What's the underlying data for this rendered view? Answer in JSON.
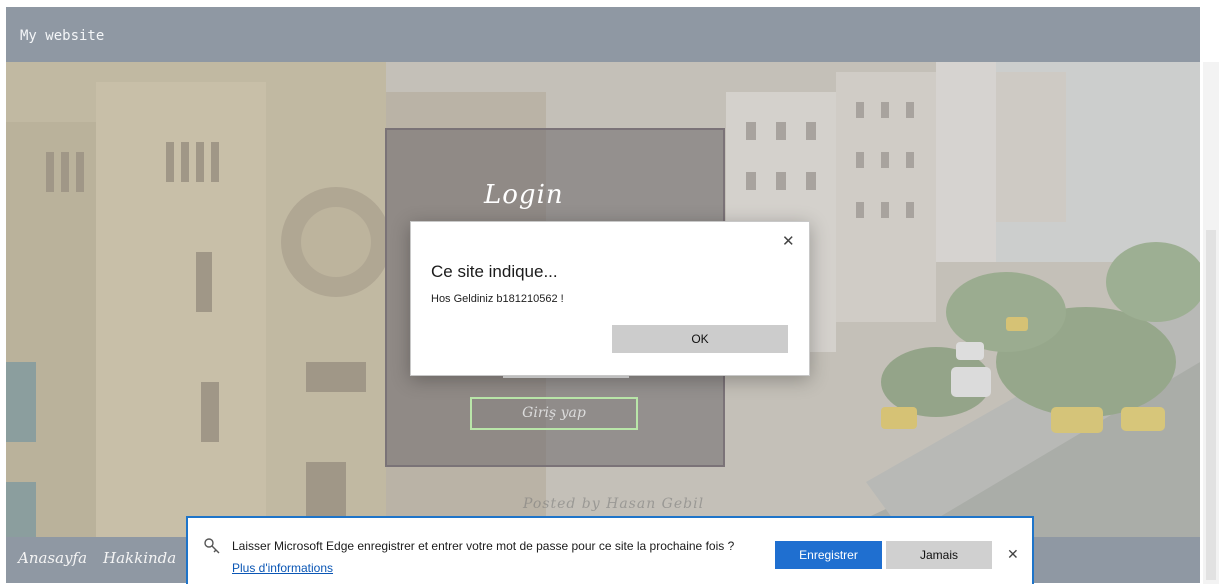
{
  "header": {
    "site_title": "My website"
  },
  "login": {
    "title": "Login",
    "submit_label": "Giriş yap",
    "watermark": "Posted by Hasan Gebil"
  },
  "footer": {
    "links": [
      "Anasayfa",
      "Hakkinda"
    ]
  },
  "alert": {
    "title": "Ce site indique...",
    "message": "Hos Geldiniz b181210562 !",
    "ok_label": "OK",
    "close_glyph": "✕"
  },
  "password_bar": {
    "text": "Laisser Microsoft Edge enregistrer et entrer votre mot de passe pour ce site la prochaine fois ?",
    "more_link": "Plus d'informations",
    "save_label": "Enregistrer",
    "never_label": "Jamais",
    "close_glyph": "✕"
  },
  "colors": {
    "header_bg": "#8f98a3",
    "edge_blue": "#1f6fd0",
    "link_blue": "#0a56b5",
    "login_button_border": "#b9e6a9"
  },
  "icons": {
    "password_bar": "key-icon"
  }
}
